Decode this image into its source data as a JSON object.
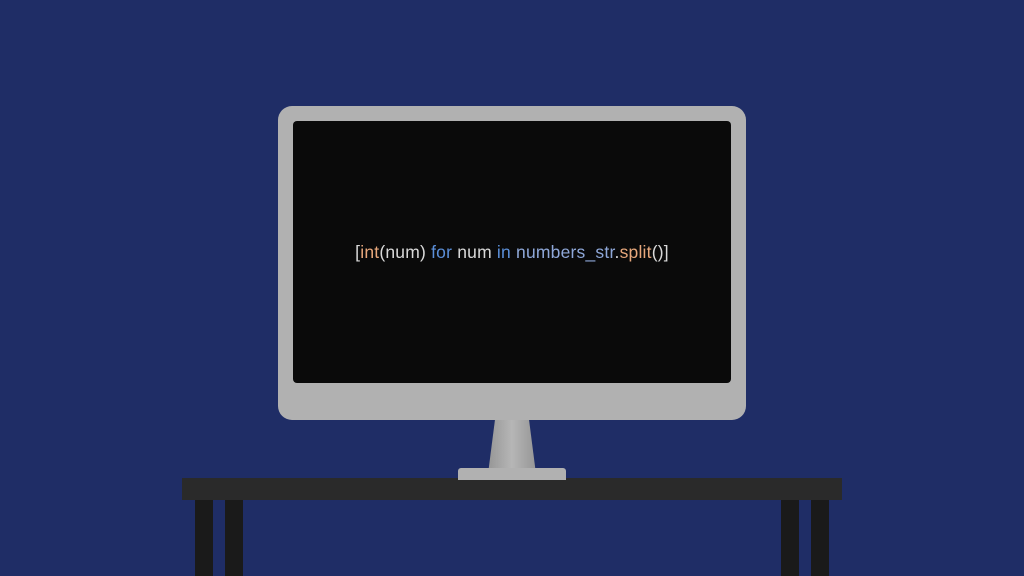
{
  "code": {
    "tokens": {
      "open_bracket": "[",
      "func_int": "int",
      "open_paren1": "(",
      "var_num1": "num",
      "close_paren1": ")",
      "space1": " ",
      "kw_for": "for",
      "space2": " ",
      "var_num2": "num",
      "space3": " ",
      "kw_in": "in",
      "space4": " ",
      "ident_numbers": "numbers_str",
      "dot": ".",
      "method_split": "split",
      "open_paren2": "(",
      "close_paren2": ")",
      "close_bracket": "]"
    }
  },
  "colors": {
    "background": "#1f2d66",
    "screen": "#0a0a0a",
    "bezel": "#b1b1b1",
    "desk": "#2a2a2a",
    "keyword": "#5b8fd9",
    "function": "#e8a87c",
    "identifier": "#8fa8d9",
    "default": "#d9d9d9"
  }
}
